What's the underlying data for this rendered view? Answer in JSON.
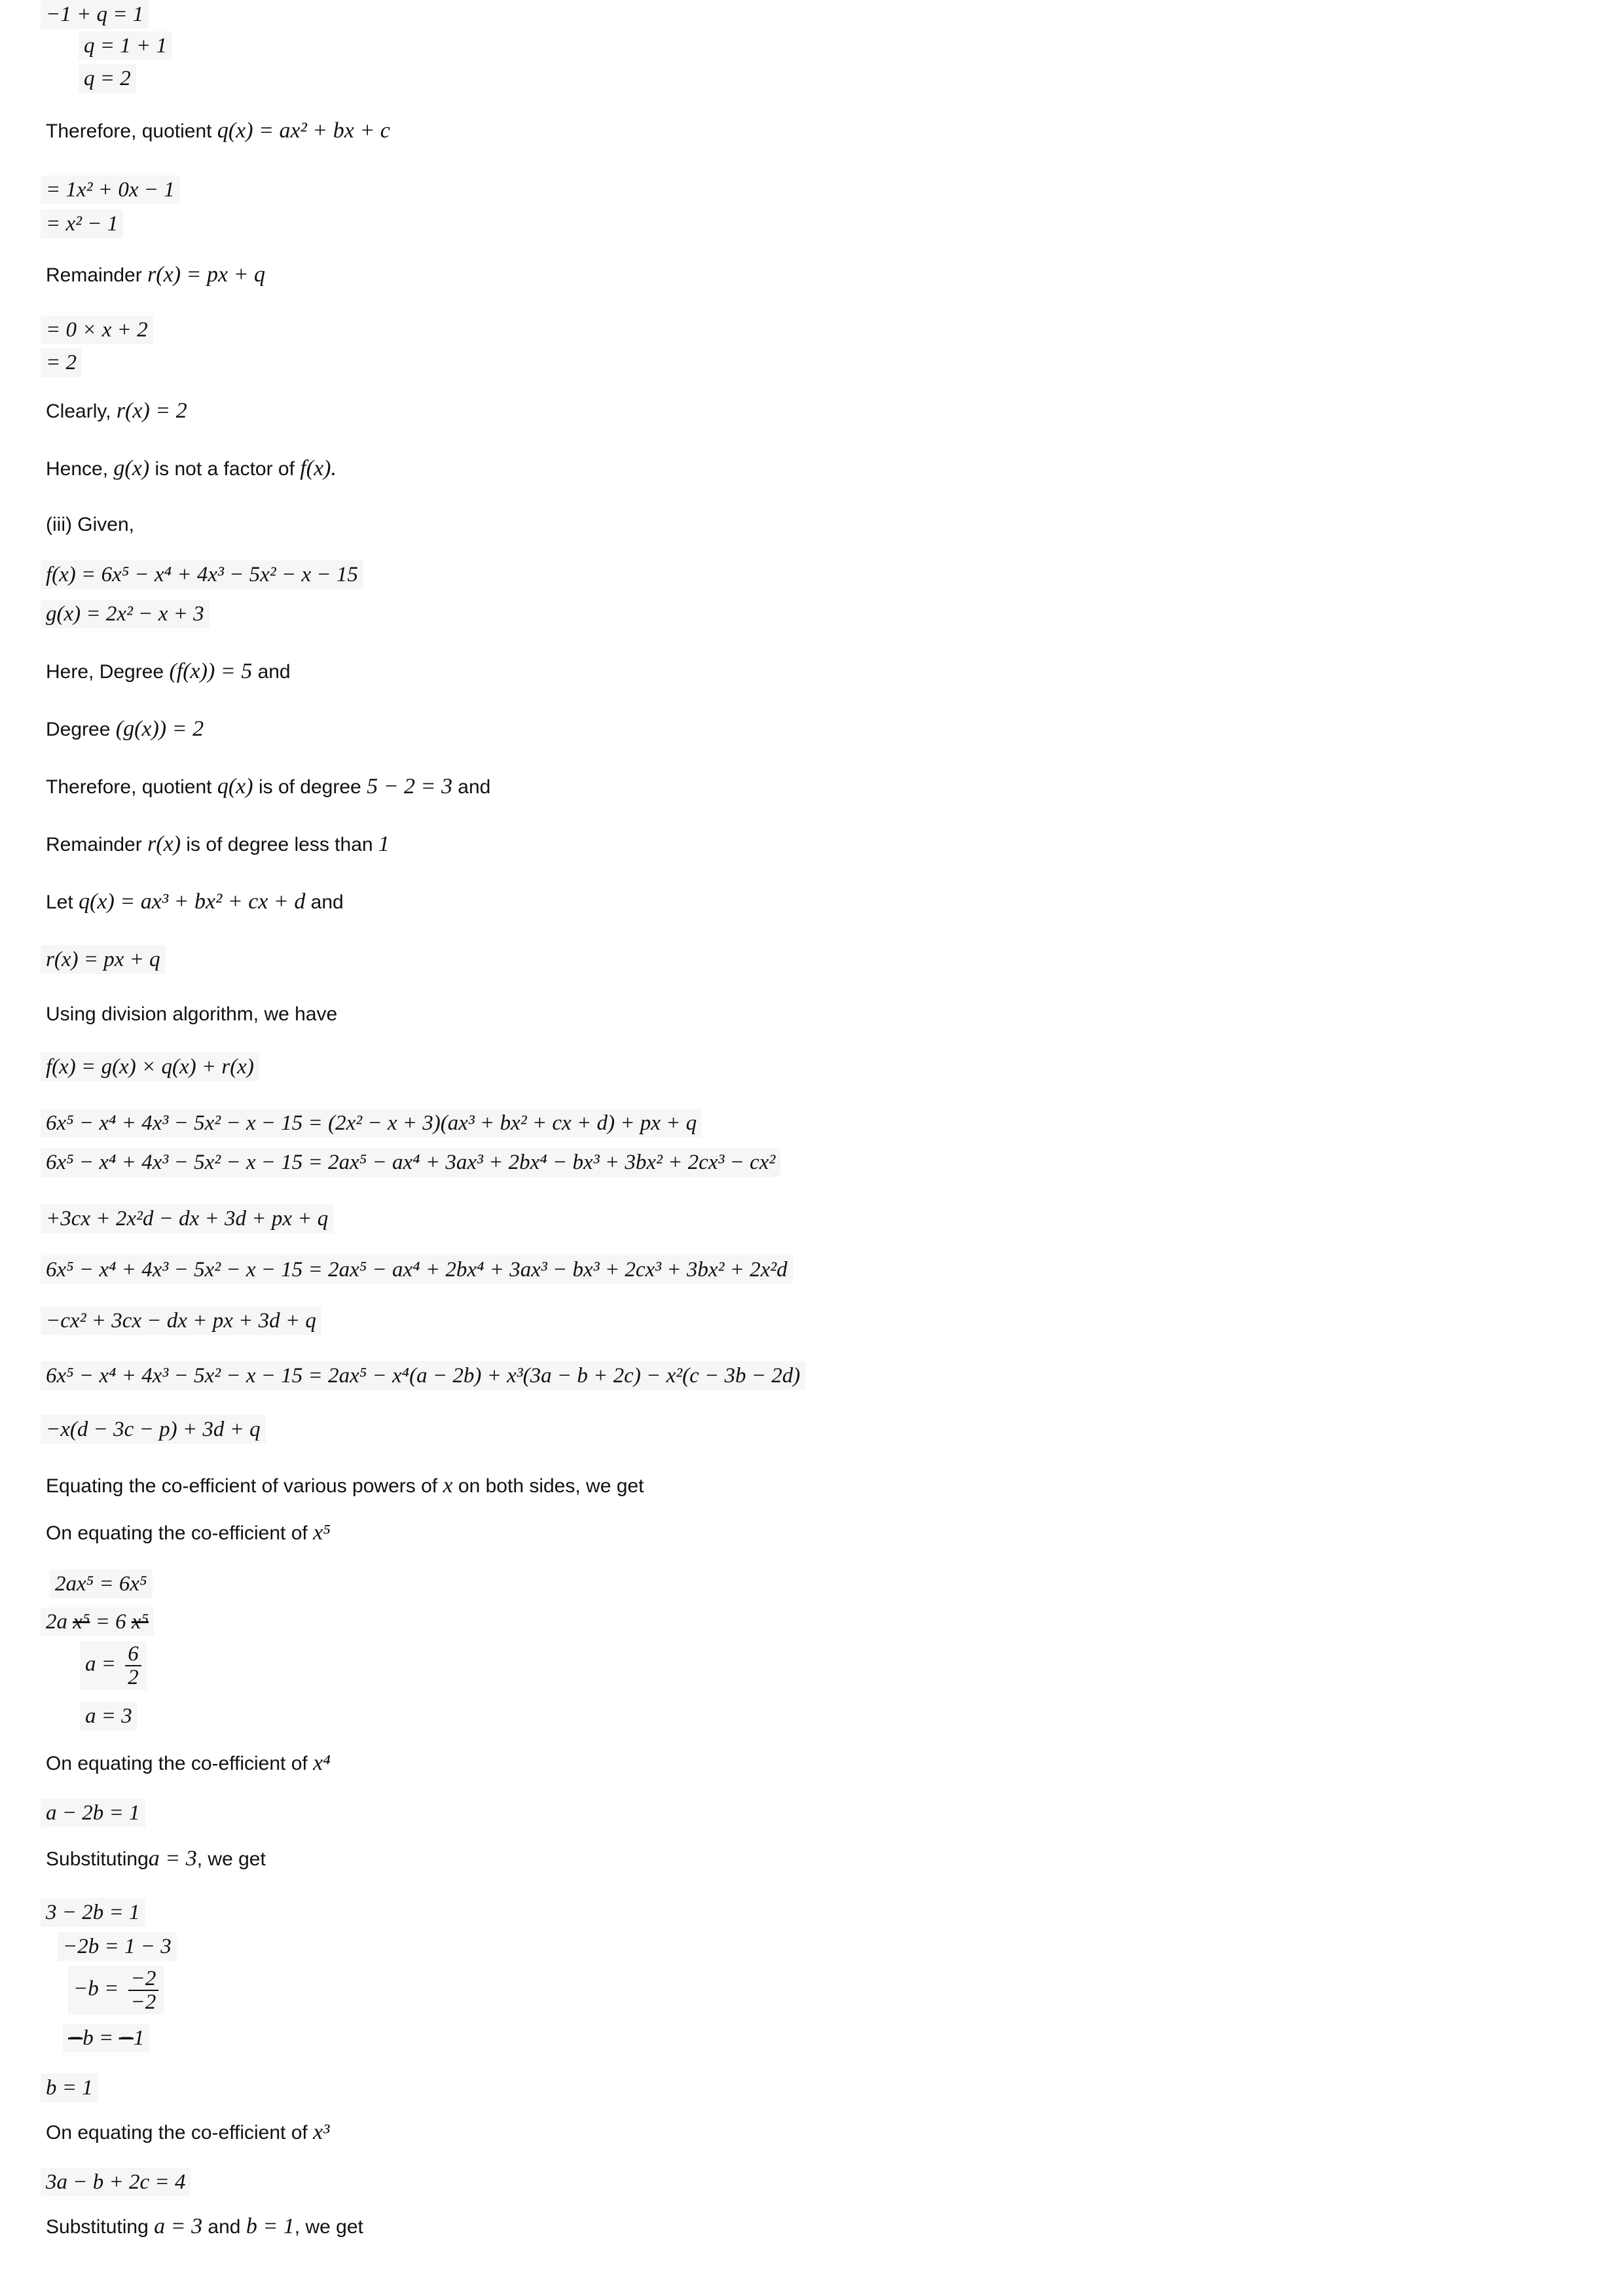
{
  "lines": {
    "l1": "−1 + q = 1",
    "l2": "q = 1 + 1",
    "l3": "q = 2",
    "p1_text": "Therefore, quotient",
    "p1_math": "q(x) = ax² + bx + c",
    "l4": "= 1x² + 0x − 1",
    "l5": "= x² − 1",
    "p2_text": "Remainder",
    "p2_math": "r(x) = px + q",
    "l6": "= 0 × x + 2",
    "l7": "= 2",
    "p3_text": "Clearly,",
    "p3_math": "r(x) = 2",
    "p4_text_a": "Hence,",
    "p4_math_a": "g(x)",
    "p4_text_b": "is not a factor of",
    "p4_math_b": "f(x).",
    "p5_text": "(iii) Given,",
    "l8": "f(x) = 6x⁵ − x⁴ + 4x³ − 5x² − x − 15",
    "l9": "g(x) = 2x² − x + 3",
    "p6_text_a": "Here, Degree",
    "p6_math": "(f(x)) = 5",
    "p6_text_b": "and",
    "p7_text": "Degree",
    "p7_math": "(g(x)) = 2",
    "p8_text_a": "Therefore, quotient",
    "p8_math_a": "q(x)",
    "p8_text_b": "is of degree",
    "p8_math_b": "5 − 2 = 3",
    "p8_text_c": "and",
    "p9_text_a": "Remainder",
    "p9_math_a": "r(x)",
    "p9_text_b": "is of degree less than",
    "p9_math_b": "1",
    "p10_text_a": "Let",
    "p10_math": "q(x) = ax³ + bx² + cx + d",
    "p10_text_b": "and",
    "l10": "r(x) = px + q",
    "p11_text": "Using division algorithm, we have",
    "l11": "f(x) = g(x) × q(x) + r(x)",
    "l12": "6x⁵ − x⁴ + 4x³ − 5x² − x − 15 = (2x² − x + 3)(ax³ + bx² + cx + d) + px + q",
    "l13": "6x⁵ − x⁴ + 4x³ − 5x² − x − 15 = 2ax⁵ − ax⁴ + 3ax³ + 2bx⁴ − bx³ + 3bx² + 2cx³ − cx²",
    "l14": "+3cx + 2x²d − dx + 3d + px + q",
    "l15": "6x⁵ − x⁴ + 4x³ − 5x² − x − 15 = 2ax⁵ − ax⁴ + 2bx⁴ + 3ax³ − bx³ + 2cx³ + 3bx² + 2x²d",
    "l16": "−cx² + 3cx − dx + px + 3d + q",
    "l17": "6x⁵ − x⁴ + 4x³ − 5x² − x − 15 = 2ax⁵ − x⁴(a − 2b) + x³(3a − b + 2c) − x²(c − 3b − 2d)",
    "l18": "−x(d − 3c − p) + 3d + q",
    "p12_text_a": "Equating the co-efficient of various powers of",
    "p12_math": "x",
    "p12_text_b": "on both sides, we get",
    "p13_text": "On equating the co-efficient of",
    "p13_math": "x⁵",
    "l19": "2ax⁵ = 6x⁵",
    "l20a": "2a",
    "l20b": "x⁵",
    "l20c": "= 6",
    "l20d": "x⁵",
    "l21a": "a =",
    "l21num": "6",
    "l21den": "2",
    "l22": "a = 3",
    "p14_text": "On equating the co-efficient of",
    "p14_math": "x⁴",
    "l23": "a − 2b = 1",
    "p15_text_a": "Substituting",
    "p15_math": "a = 3",
    "p15_text_b": ", we get",
    "l24": "3 − 2b = 1",
    "l25": "−2b = 1 − 3",
    "l26a": "−b =",
    "l26num": "−2",
    "l26den": "−2",
    "l27a": "−",
    "l27b": "b = ",
    "l27c": "−",
    "l27d": "1",
    "l28": "b = 1",
    "p16_text": "On equating the co-efficient of",
    "p16_math": "x³",
    "l29": "3a − b + 2c = 4",
    "p17_text_a": "Substituting",
    "p17_math_a": "a = 3",
    "p17_text_b": "and",
    "p17_math_b": "b = 1",
    "p17_text_c": ", we get"
  }
}
